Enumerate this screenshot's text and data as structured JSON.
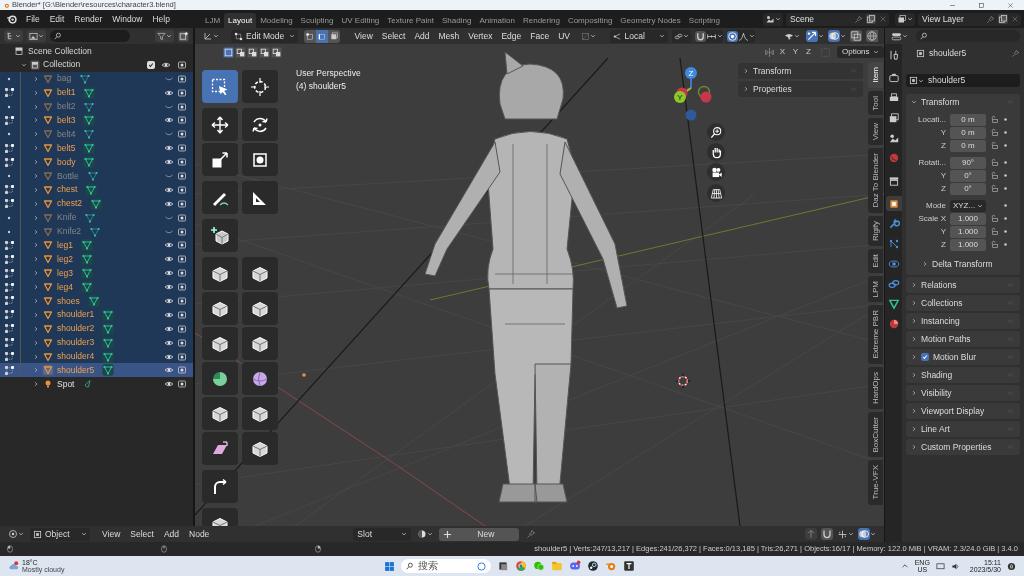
{
  "title_bar": {
    "title": "Blender* [G:\\Blender\\resources\\character3.blend]"
  },
  "menu": [
    "File",
    "Edit",
    "Render",
    "Window",
    "Help"
  ],
  "workspaces": [
    {
      "label": "LJM",
      "selected": false
    },
    {
      "label": "Layout",
      "selected": true
    },
    {
      "label": "Modeling",
      "selected": false
    },
    {
      "label": "Sculpting",
      "selected": false
    },
    {
      "label": "UV Editing",
      "selected": false
    },
    {
      "label": "Texture Paint",
      "selected": false
    },
    {
      "label": "Shading",
      "selected": false
    },
    {
      "label": "Animation",
      "selected": false
    },
    {
      "label": "Rendering",
      "selected": false
    },
    {
      "label": "Compositing",
      "selected": false
    },
    {
      "label": "Geometry Nodes",
      "selected": false
    },
    {
      "label": "Scripting",
      "selected": false
    }
  ],
  "scene": "Scene",
  "view_layer": "View Layer",
  "outliner": {
    "root": "Scene Collection",
    "collection": {
      "label": "Collection",
      "checked": true,
      "expanded": true
    },
    "items": [
      {
        "name": "bag",
        "kind": "mesh",
        "hidden": true,
        "selected": true,
        "active": false
      },
      {
        "name": "belt1",
        "kind": "mesh",
        "hidden": false,
        "selected": true,
        "active": false
      },
      {
        "name": "belt2",
        "kind": "mesh",
        "hidden": true,
        "selected": true,
        "active": false
      },
      {
        "name": "belt3",
        "kind": "mesh",
        "hidden": false,
        "selected": true,
        "active": false
      },
      {
        "name": "belt4",
        "kind": "mesh",
        "hidden": true,
        "selected": true,
        "active": false
      },
      {
        "name": "belt5",
        "kind": "mesh",
        "hidden": false,
        "selected": true,
        "active": false
      },
      {
        "name": "body",
        "kind": "mesh",
        "hidden": false,
        "selected": true,
        "active": false
      },
      {
        "name": "Bottle",
        "kind": "mesh",
        "hidden": true,
        "selected": true,
        "active": false
      },
      {
        "name": "chest",
        "kind": "mesh",
        "hidden": false,
        "selected": true,
        "active": false
      },
      {
        "name": "chest2",
        "kind": "mesh",
        "hidden": false,
        "selected": true,
        "active": false
      },
      {
        "name": "Knife",
        "kind": "mesh",
        "hidden": true,
        "selected": true,
        "active": false
      },
      {
        "name": "Knife2",
        "kind": "mesh",
        "hidden": true,
        "selected": true,
        "active": false
      },
      {
        "name": "leg1",
        "kind": "mesh",
        "hidden": false,
        "selected": true,
        "active": false
      },
      {
        "name": "leg2",
        "kind": "mesh",
        "hidden": false,
        "selected": true,
        "active": false
      },
      {
        "name": "leg3",
        "kind": "mesh",
        "hidden": false,
        "selected": true,
        "active": false
      },
      {
        "name": "leg4",
        "kind": "mesh",
        "hidden": false,
        "selected": true,
        "active": false
      },
      {
        "name": "shoes",
        "kind": "mesh",
        "hidden": false,
        "selected": true,
        "active": false
      },
      {
        "name": "shoulder1",
        "kind": "mesh",
        "hidden": false,
        "selected": true,
        "active": false
      },
      {
        "name": "shoulder2",
        "kind": "mesh",
        "hidden": false,
        "selected": true,
        "active": false
      },
      {
        "name": "shoulder3",
        "kind": "mesh",
        "hidden": false,
        "selected": true,
        "active": false
      },
      {
        "name": "shoulder4",
        "kind": "mesh",
        "hidden": false,
        "selected": true,
        "active": false
      },
      {
        "name": "shoulder5",
        "kind": "mesh",
        "hidden": false,
        "selected": true,
        "active": true
      },
      {
        "name": "Spot",
        "kind": "light",
        "hidden": false,
        "selected": false,
        "active": false
      }
    ]
  },
  "viewport": {
    "mode": "Edit Mode",
    "select_modes": [
      {
        "kind": "vertex",
        "selected": false
      },
      {
        "kind": "edge",
        "selected": true
      },
      {
        "kind": "face",
        "selected": false
      }
    ],
    "menu": [
      "View",
      "Select",
      "Add",
      "Mesh",
      "Vertex",
      "Edge",
      "Face",
      "UV"
    ],
    "orientation": "Local",
    "mirror_axes": [
      "X",
      "Y",
      "Z"
    ],
    "options": "Options",
    "view_name": "User Perspective",
    "object_label": "(4) shoulder5",
    "gizmo_labels": [
      "Z",
      "Y"
    ],
    "sidebar_panels": [
      "Transform",
      "Properties"
    ],
    "sidebar_tabs": [
      {
        "label": "Item",
        "selected": true
      },
      {
        "label": "Tool",
        "selected": false
      },
      {
        "label": "View",
        "selected": false
      },
      {
        "label": "Daz To Blender",
        "selected": false
      },
      {
        "label": "Rigify",
        "selected": false
      },
      {
        "label": "Edit",
        "selected": false
      },
      {
        "label": "LPM",
        "selected": false
      },
      {
        "label": "Extreme PBR",
        "selected": false
      },
      {
        "label": "HardOps",
        "selected": false
      },
      {
        "label": "BoxCutter",
        "selected": false
      },
      {
        "label": "True-VFX",
        "selected": false
      }
    ],
    "tool_groups": [
      [
        {
          "kind": "select_box",
          "selected": true
        },
        {
          "kind": "cursor",
          "selected": false
        }
      ],
      [
        {
          "kind": "move",
          "selected": false
        },
        {
          "kind": "rotate",
          "selected": false
        },
        {
          "kind": "scale",
          "selected": false
        },
        {
          "kind": "transform",
          "selected": false
        }
      ],
      [
        {
          "kind": "annotate",
          "selected": false
        },
        {
          "kind": "measure",
          "selected": false
        }
      ],
      [
        {
          "kind": "add_cube",
          "selected": false
        }
      ],
      [
        {
          "kind": "extrude",
          "selected": false
        },
        {
          "kind": "inset",
          "selected": false
        },
        {
          "kind": "bevel",
          "selected": false
        },
        {
          "kind": "loop_cut",
          "selected": false
        },
        {
          "kind": "knife",
          "selected": false
        },
        {
          "kind": "poly_build",
          "selected": false
        },
        {
          "kind": "spin",
          "selected": false
        },
        {
          "kind": "smooth",
          "selected": false
        },
        {
          "kind": "edge_slide",
          "selected": false
        },
        {
          "kind": "shrink",
          "selected": false
        },
        {
          "kind": "shear",
          "selected": false
        },
        {
          "kind": "rip",
          "selected": false
        }
      ],
      [
        {
          "kind": "curve",
          "selected": false
        }
      ],
      [
        {
          "kind": "cube",
          "selected": false
        }
      ]
    ]
  },
  "properties": {
    "tabs": [
      {
        "kind": "tool",
        "selected": false
      },
      {
        "kind": "render",
        "selected": false
      },
      {
        "kind": "output",
        "selected": false
      },
      {
        "kind": "view_layer",
        "selected": false
      },
      {
        "kind": "scene",
        "selected": false
      },
      {
        "kind": "world",
        "selected": false
      },
      {
        "kind": "collection",
        "selected": false
      },
      {
        "kind": "object",
        "selected": true
      },
      {
        "kind": "modifiers",
        "selected": false
      },
      {
        "kind": "particles",
        "selected": false
      },
      {
        "kind": "physics",
        "selected": false
      },
      {
        "kind": "constraints",
        "selected": false
      },
      {
        "kind": "data",
        "selected": false
      },
      {
        "kind": "material",
        "selected": false
      }
    ],
    "object": "shoulder5",
    "data_name": "shoulder5",
    "transform": {
      "title": "Transform",
      "groups": [
        [
          {
            "label": "Locati...",
            "value": "0 m",
            "kind": "number"
          },
          {
            "label": "Y",
            "value": "0 m",
            "kind": "number"
          },
          {
            "label": "Z",
            "value": "0 m",
            "kind": "number"
          }
        ],
        [
          {
            "label": "Rotati...",
            "value": "90°",
            "kind": "number"
          },
          {
            "label": "Y",
            "value": "0°",
            "kind": "number"
          },
          {
            "label": "Z",
            "value": "0°",
            "kind": "number"
          }
        ],
        [
          {
            "label": "Mode",
            "value": "XYZ...",
            "kind": "dropdown"
          },
          {
            "label": "Scale X",
            "value": "1.000",
            "kind": "number"
          },
          {
            "label": "Y",
            "value": "1.000",
            "kind": "number"
          },
          {
            "label": "Z",
            "value": "1.000",
            "kind": "number"
          }
        ]
      ],
      "subpanel": "Delta Transform"
    },
    "panels": [
      {
        "title": "Relations",
        "kind": "plain"
      },
      {
        "title": "Collections",
        "kind": "plain"
      },
      {
        "title": "Instancing",
        "kind": "plain"
      },
      {
        "title": "Motion Paths",
        "kind": "plain"
      },
      {
        "title": "Motion Blur",
        "kind": "toggle",
        "checked": true
      },
      {
        "title": "Shading",
        "kind": "plain"
      },
      {
        "title": "Visibility",
        "kind": "plain"
      },
      {
        "title": "Viewport Display",
        "kind": "plain"
      },
      {
        "title": "Line Art",
        "kind": "plain"
      },
      {
        "title": "Custom Properties",
        "kind": "plain"
      }
    ]
  },
  "node_header": {
    "object_mode": "Object",
    "menu": [
      "View",
      "Select",
      "Add",
      "Node"
    ],
    "slot": "Slot",
    "new": "New"
  },
  "status_bar": {
    "text": "shoulder5 | Verts:247/13,217 | Edges:241/26,372 | Faces:0/13,185 | Tris:26,271 | Objects:16/17 | Memory: 122.0 MiB | VRAM: 2.3/24.0 GiB | 3.4.0"
  },
  "taskbar": {
    "temperature": "18°C",
    "weather": "Mostly cloudy",
    "search": "搜索",
    "language": "ENG",
    "region": "US",
    "time": "15:11",
    "date": "2023/5/30"
  }
}
